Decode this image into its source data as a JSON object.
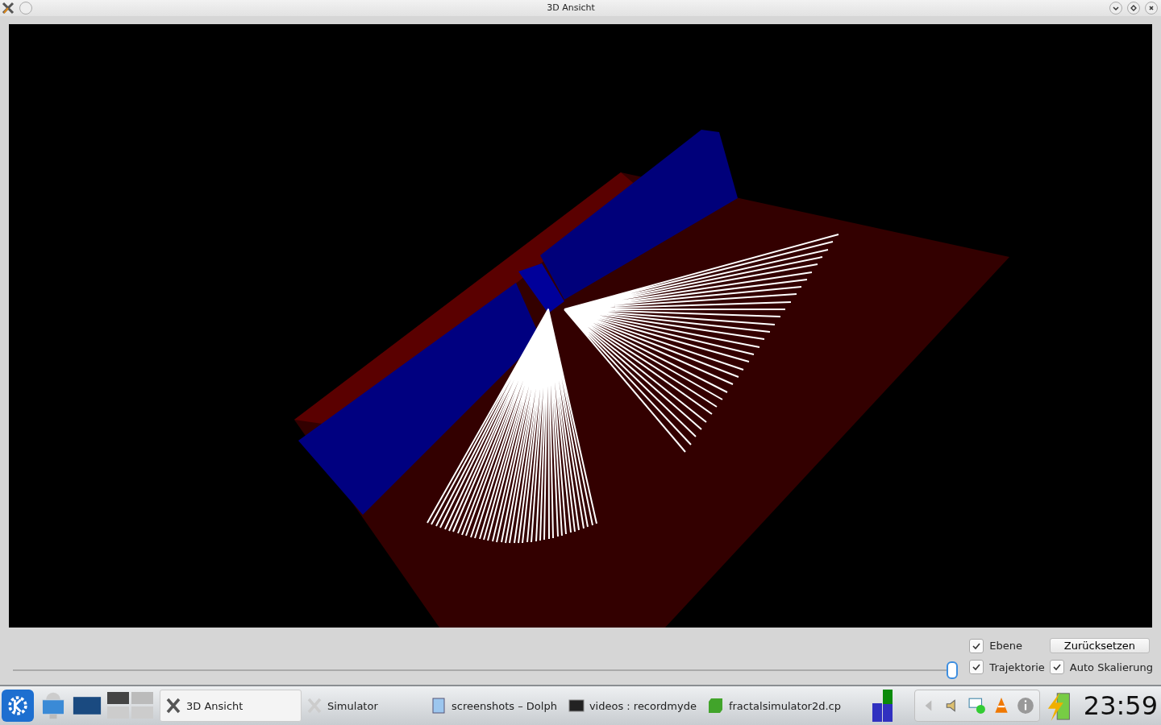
{
  "window": {
    "title": "3D Ansicht"
  },
  "slider": {
    "level": 1.0
  },
  "options": [
    {
      "label": "Ebene",
      "checked": true
    },
    {
      "label": "Trajektorie",
      "checked": true
    },
    {
      "label": "Auto Skalierung",
      "checked": true
    }
  ],
  "reset_button": "Zurücksetzen",
  "taskbar": {
    "tasks": [
      {
        "label": "3D Ansicht",
        "kind": "x",
        "selected": true
      },
      {
        "label": "Simulator",
        "kind": "x",
        "selected": false
      },
      {
        "label": "screenshots – Dolph",
        "kind": "folder",
        "selected": false
      },
      {
        "label": "videos : recordmyde",
        "kind": "terminal",
        "selected": false
      },
      {
        "label": "fractalsimulator2d.cp",
        "kind": "qt",
        "selected": false
      }
    ],
    "clock": "23:59"
  }
}
